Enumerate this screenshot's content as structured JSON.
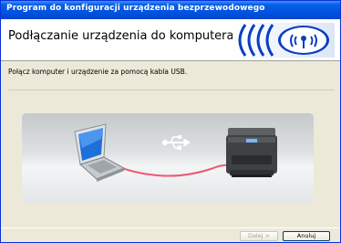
{
  "window": {
    "title": "Program do konfiguracji urządzenia bezprzewodowego"
  },
  "header": {
    "title": "Podłączanie urządzenia do komputera"
  },
  "content": {
    "instruction": "Połącz komputer i urządzenie za pomocą kabla USB."
  },
  "buttons": {
    "next_label": "Dalej >",
    "cancel_label": "Anuluj"
  },
  "colors": {
    "titlebar": "#0054e3",
    "logo_blue": "#0a3fbf",
    "cable": "#ef5870"
  },
  "icons": {
    "logo": "wireless-signal-icon",
    "usb": "usb-icon"
  }
}
